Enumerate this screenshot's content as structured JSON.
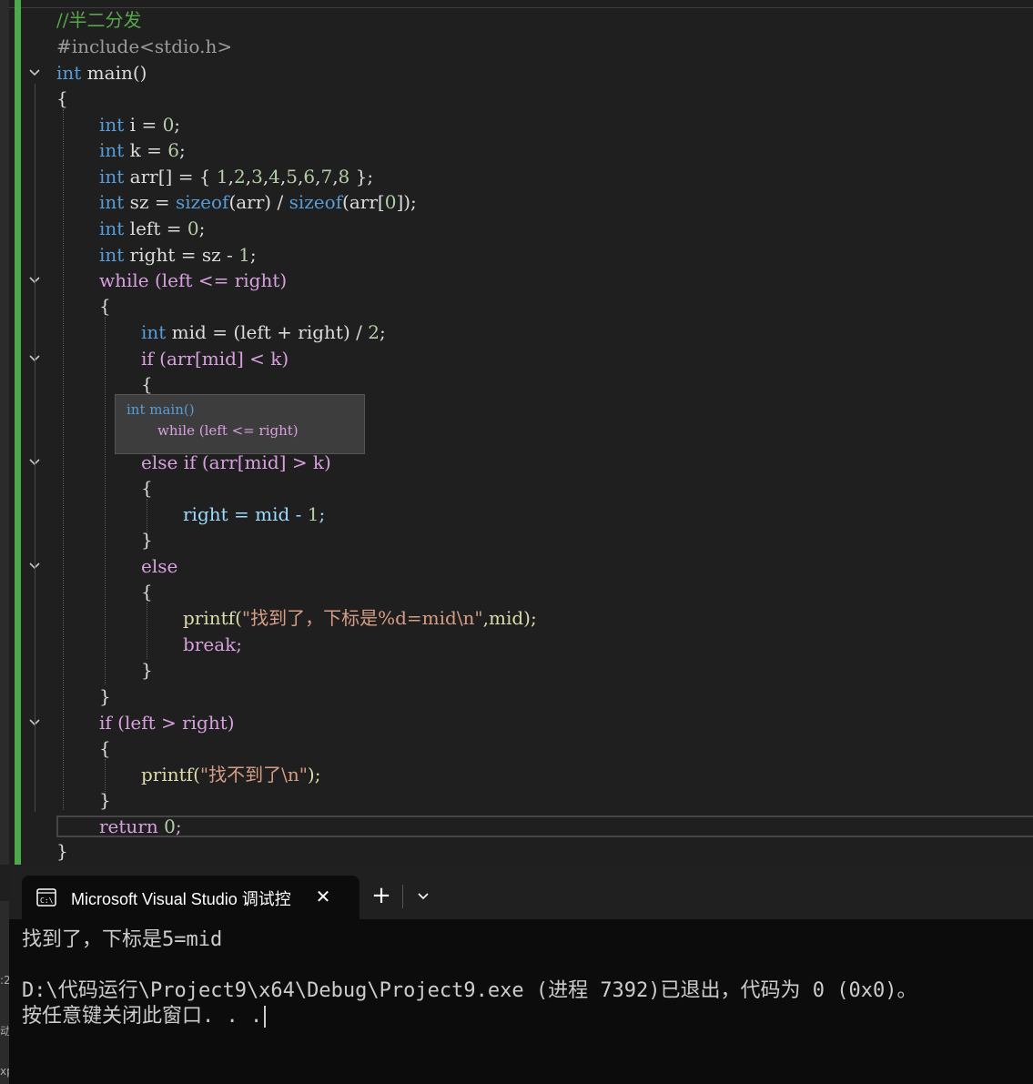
{
  "editor": {
    "lines": [
      [
        "//半二分发"
      ],
      [
        "#include<stdio.h>"
      ],
      [
        "int main()"
      ],
      [
        "{"
      ],
      [
        "int i = 0;"
      ],
      [
        "int k = 6;"
      ],
      [
        "int arr[] = { 1,2,3,4,5,6,7,8 };"
      ],
      [
        "int sz = sizeof(arr) / sizeof(arr[0]);"
      ],
      [
        "int left = 0;"
      ],
      [
        "int right = sz - 1;"
      ],
      [
        "while (left <= right)"
      ],
      [
        "{"
      ],
      [
        "int mid = (left + right) / 2;"
      ],
      [
        "if (arr[mid] < k)"
      ],
      [
        "{"
      ],
      [
        "else if (arr[mid] > k)"
      ],
      [
        "{"
      ],
      [
        "right = mid - 1;"
      ],
      [
        "}"
      ],
      [
        "else"
      ],
      [
        "{"
      ],
      [
        "printf(\"找到了，下标是%d=mid\\n\",mid);"
      ],
      [
        "break;"
      ],
      [
        "}"
      ],
      [
        "}"
      ],
      [
        "if (left > right)"
      ],
      [
        "{"
      ],
      [
        "printf(\"找不到了\\n\");"
      ],
      [
        "}"
      ],
      [
        "return 0;"
      ],
      [
        "}"
      ]
    ],
    "sticky_scroll": {
      "line1": "int main()",
      "line2": "while (left <= right)"
    },
    "colors": {
      "keyword": "#569cd6",
      "control": "#d8a0df",
      "number": "#b5cea8",
      "string": "#d69d85",
      "comment": "#57a64a",
      "change_bar": "#4ea94b"
    }
  },
  "terminal": {
    "tab_title": "Microsoft Visual Studio 调试控",
    "tab_icon": "console-icon",
    "close_icon": "close-icon",
    "new_tab_icon": "plus-icon",
    "dropdown_icon": "chevron-down-icon",
    "output": [
      "找到了，下标是5=mid",
      "",
      "D:\\代码运行\\Project9\\x64\\Debug\\Project9.exe (进程 7392)已退出，代码为 0 (0x0)。",
      "按任意键关闭此窗口. . ."
    ]
  },
  "background": {
    "fragments": [
      ":2",
      "动",
      "xp"
    ]
  }
}
